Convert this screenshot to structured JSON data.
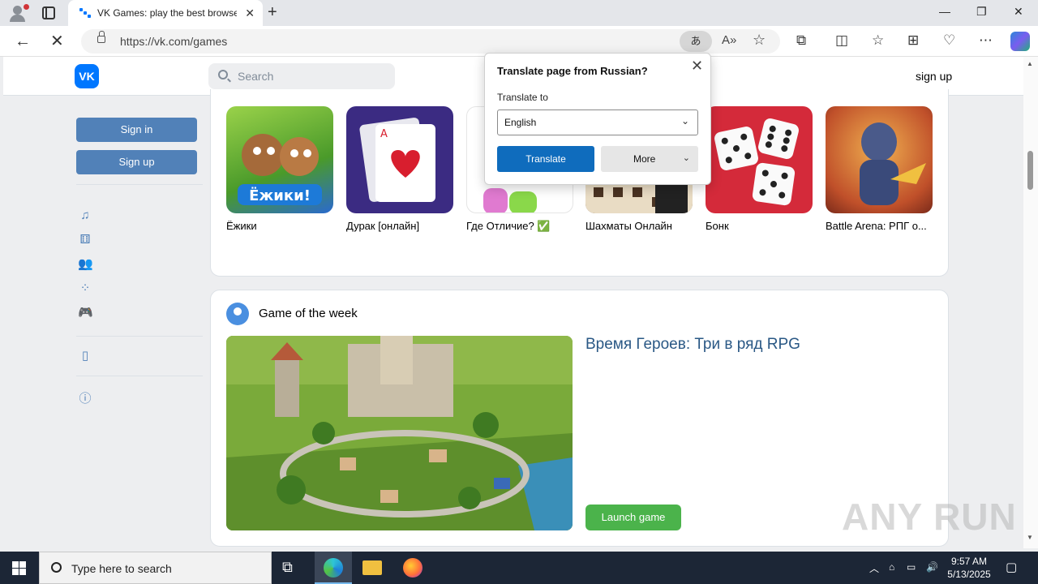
{
  "browser": {
    "tab_title": "VK Games: play the best browser",
    "url": "https://vk.com/games",
    "translate_icon_text": "あ",
    "window_controls": {
      "minimize": "—",
      "maximize": "❐",
      "close": "✕"
    }
  },
  "vk": {
    "logo_text": "VK",
    "search_placeholder": "Search",
    "signup_link": "sign up",
    "sidebar": {
      "sign_in": "Sign in",
      "sign_up": "Sign up",
      "icons": [
        "music-icon",
        "dice-icon",
        "people-icon",
        "apps-icon",
        "gamepad-icon",
        "phone-icon",
        "info-icon"
      ]
    },
    "games_row": [
      {
        "name": "Ёжики",
        "color": "#7bbf3a"
      },
      {
        "name": "Дурак [онлайн]",
        "color": "#3a2a7a"
      },
      {
        "name": "Где Отличие? ✅",
        "color": "#e8f7e0"
      },
      {
        "name": "Шахматы Онлайн",
        "color": "#6d4a2a"
      },
      {
        "name": "Бонк",
        "color": "#d42a3a"
      },
      {
        "name": "Battle Arena: РПГ о...",
        "color": "#c86a2a"
      }
    ],
    "game_of_week": {
      "heading": "Game of the week",
      "title": "Время Героев: Три в ряд RPG",
      "launch": "Launch game"
    }
  },
  "translate_popup": {
    "title": "Translate page from Russian?",
    "label": "Translate to",
    "language": "English",
    "translate_btn": "Translate",
    "more_btn": "More"
  },
  "taskbar": {
    "search_text": "Type here to search",
    "time": "9:57 AM",
    "date": "5/13/2025"
  },
  "watermark": "ANY RUN"
}
